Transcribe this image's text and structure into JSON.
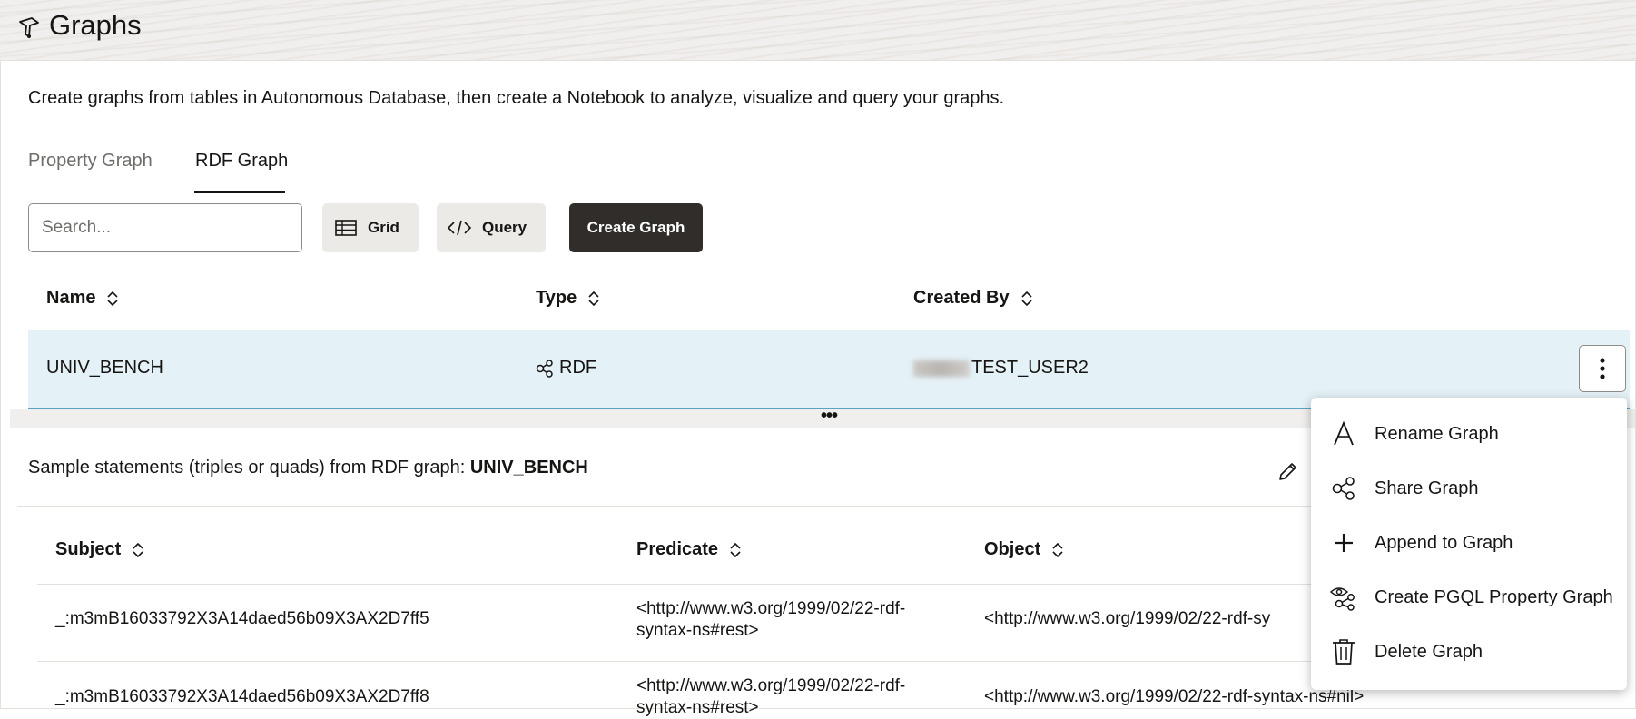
{
  "header": {
    "title": "Graphs",
    "icon": "graph-studio-logo-icon"
  },
  "description": "Create graphs from tables in Autonomous Database, then create a Notebook to analyze, visualize and query your graphs.",
  "tabs": [
    {
      "label": "Property Graph",
      "active": false
    },
    {
      "label": "RDF Graph",
      "active": true
    }
  ],
  "toolbar": {
    "search_placeholder": "Search...",
    "search_value": "",
    "grid_label": "Grid",
    "query_label": "Query",
    "create_label": "Create Graph"
  },
  "graph_table": {
    "columns": [
      "Name",
      "Type",
      "Created By"
    ],
    "rows": [
      {
        "name": "UNIV_BENCH",
        "type": "RDF",
        "created_by": "TEST_USER2"
      }
    ]
  },
  "splitter_label": "•••",
  "sample": {
    "title_prefix": "Sample statements (triples or quads) from RDF graph: ",
    "graph_name": "UNIV_BENCH",
    "columns": [
      "Subject",
      "Predicate",
      "Object"
    ],
    "rows": [
      {
        "subject": "_:m3mB16033792X3A14daed56b09X3AX2D7ff5",
        "predicate": "<http://www.w3.org/1999/02/22-rdf-syntax-ns#rest>",
        "object": "<http://www.w3.org/1999/02/22-rdf-sy"
      },
      {
        "subject": "_:m3mB16033792X3A14daed56b09X3AX2D7ff8",
        "predicate": "<http://www.w3.org/1999/02/22-rdf-syntax-ns#rest>",
        "object": "<http://www.w3.org/1999/02/22-rdf-syntax-ns#nil>"
      }
    ]
  },
  "menu": {
    "items": [
      {
        "label": "Rename Graph",
        "icon": "rename-icon"
      },
      {
        "label": "Share Graph",
        "icon": "share-icon"
      },
      {
        "label": "Append to Graph",
        "icon": "plus-icon"
      },
      {
        "label": "Create PGQL Property Graph",
        "icon": "pgql-graph-icon"
      },
      {
        "label": "Delete Graph",
        "icon": "trash-icon"
      }
    ]
  },
  "colors": {
    "primary_button": "#312d2a",
    "selected_row": "#e4f1f7",
    "selected_row_border": "#5aa3c4",
    "text": "#161513",
    "muted_text": "#6f6c69"
  }
}
